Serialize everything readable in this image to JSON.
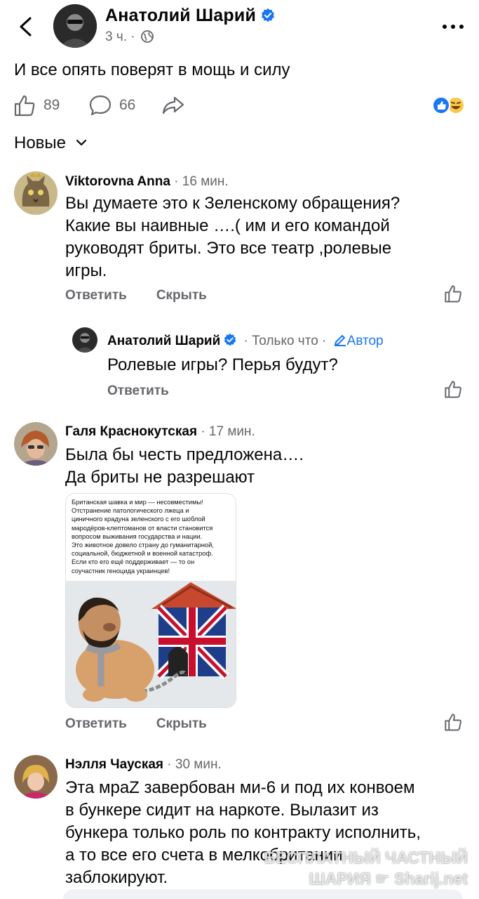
{
  "header": {
    "author": "Анатолий Шарий",
    "meta": "3 ч. ·"
  },
  "post": {
    "text": "И все опять поверят в мощь и силу",
    "likes": "89",
    "comments": "66"
  },
  "sort": {
    "label": "Новые"
  },
  "comments": [
    {
      "name": "Viktorovna Anna",
      "time": "· 16 мин.",
      "lines": [
        "Вы думаете это к Зеленскому обращения?",
        "Какие вы наивные ….( им и его командой",
        "руководят бриты. Это все театр ,ролевые",
        "игры."
      ],
      "reply": "Ответить",
      "hide": "Скрыть"
    },
    {
      "name": "Анатолий Шарий",
      "time": "· Только что ·",
      "tag": "Автор",
      "text": "Ролевые игры? Перья будут?",
      "reply": "Ответить"
    },
    {
      "name": "Галя Краснокутская",
      "time": "· 17 мин.",
      "lines": [
        "Была бы честь предложена….",
        "Да бриты не разрешают"
      ],
      "reply": "Ответить",
      "hide": "Скрыть"
    },
    {
      "name": "Нэлля Чауская",
      "time": "· 30 мин.",
      "lines": [
        "Эта мраZ завербован ми-6 и под их конвоем",
        "в бункере сидит на наркоте. Вылазит из",
        "бункера только роль по контракту исполнить,",
        "а то все его счета в мелкобритании",
        "заблокируют."
      ]
    }
  ],
  "attachment": {
    "lines": [
      "Британская шавка и мир — несовместимы!",
      "Отстранение патологического лжеца и",
      "циничного крадуна зеленского с его шоблой",
      "мародёров-клептоманов от власти становится",
      "вопросом выживания государства и нации.",
      "Это животное довело страну до гуманитарной,",
      "социальной, бюджетной и военной катастроф.",
      "Если кто его ещё поддерживает — то он",
      "соучастник геноцида украинцев!"
    ]
  },
  "watermark": {
    "line1": "БЕСПЛАТНЫЙ ЧАСТНЫЙ",
    "line2": "ШАРИЯ",
    "line3": "Sharij.net"
  },
  "colors": {
    "accent": "#1877f2",
    "muted": "#65676b",
    "text": "#050505"
  }
}
